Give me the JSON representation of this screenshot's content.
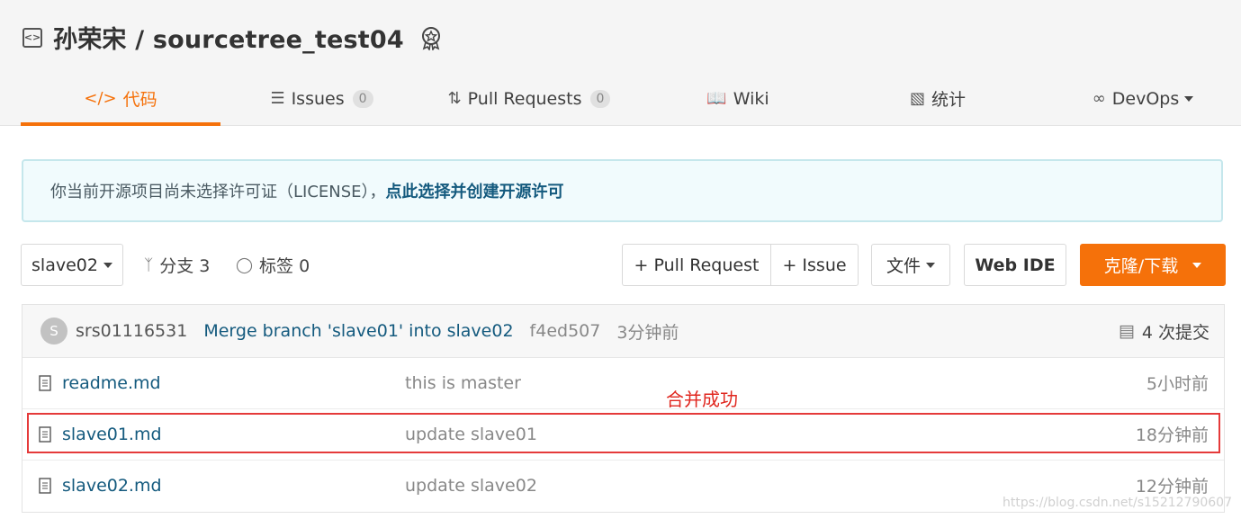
{
  "header": {
    "repo_title": "孙荣宋 / sourcetree_test04",
    "tabs": [
      {
        "label": "代码",
        "icon": "code-icon",
        "active": true
      },
      {
        "label": "Issues",
        "icon": "issues-icon",
        "count": "0"
      },
      {
        "label": "Pull Requests",
        "icon": "pull-request-icon",
        "count": "0"
      },
      {
        "label": "Wiki",
        "icon": "wiki-icon"
      },
      {
        "label": "统计",
        "icon": "stats-icon"
      },
      {
        "label": "DevOps",
        "icon": "infinity-icon"
      }
    ]
  },
  "notice": {
    "text": "你当前开源项目尚未选择许可证（LICENSE），",
    "link": "点此选择并创建开源许可"
  },
  "toolbar": {
    "branch": "slave02",
    "branches": "分支 3",
    "tags": "标签 0",
    "pull_request": "+ Pull Request",
    "issue": "+ Issue",
    "file": "文件",
    "web_ide": "Web IDE",
    "clone": "克隆/下载"
  },
  "commit": {
    "avatar": "S",
    "author": "srs01116531",
    "message": "Merge branch 'slave01' into slave02",
    "hash": "f4ed507",
    "time": "3分钟前",
    "count": "4 次提交"
  },
  "files": [
    {
      "name": "readme.md",
      "message": "this is master",
      "time": "5小时前"
    },
    {
      "name": "slave01.md",
      "message": "update slave01",
      "time": "18分钟前"
    },
    {
      "name": "slave02.md",
      "message": "update slave02",
      "time": "12分钟前"
    }
  ],
  "annotation": "合并成功",
  "watermark": "https://blog.csdn.net/s15212790607",
  "colors": {
    "accent": "#f5710a",
    "link": "#145a7e",
    "highlight": "#e53a3a"
  }
}
